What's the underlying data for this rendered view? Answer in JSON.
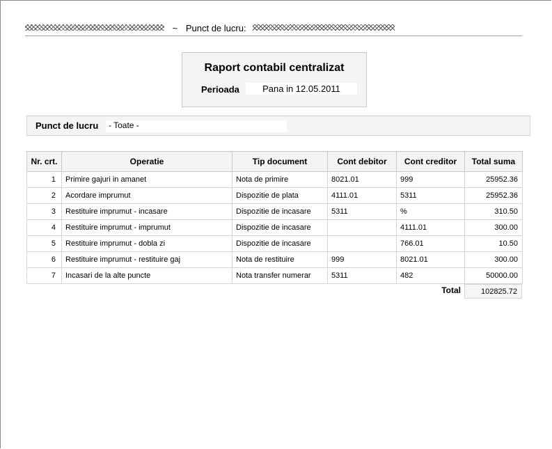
{
  "header": {
    "separator": "~",
    "workplace_label": "Punct de lucru:"
  },
  "report": {
    "title": "Raport contabil centralizat",
    "period_label": "Perioada",
    "period_value": "Pana in 12.05.2011"
  },
  "workplace_filter": {
    "label": "Punct de lucru",
    "value": "- Toate -"
  },
  "table": {
    "columns": [
      "Nr. crt.",
      "Operatie",
      "Tip document",
      "Cont debitor",
      "Cont creditor",
      "Total suma"
    ],
    "rows": [
      [
        "1",
        "Primire gajuri in amanet",
        "Nota de primire",
        "8021.01",
        "999",
        "25952.36"
      ],
      [
        "2",
        "Acordare imprumut",
        "Dispozitie de plata",
        "4111.01",
        "5311",
        "25952.36"
      ],
      [
        "3",
        "Restituire imprumut - incasare",
        "Dispozitie de incasare",
        "5311",
        "%",
        "310.50"
      ],
      [
        "4",
        "Restituire imprumut - imprumut",
        "Dispozitie de incasare",
        "",
        "4111.01",
        "300.00"
      ],
      [
        "5",
        "Restituire imprumut - dobla zi",
        "Dispozitie de incasare",
        "",
        "766.01",
        "10.50"
      ],
      [
        "6",
        "Restituire imprumut - restituire gaj",
        "Nota de restituire",
        "999",
        "8021.01",
        "300.00"
      ],
      [
        "7",
        "Incasari de la alte puncte",
        "Nota transfer numerar",
        "5311",
        "482",
        "50000.00"
      ]
    ],
    "total_label": "Total",
    "total_value": "102825.72"
  }
}
